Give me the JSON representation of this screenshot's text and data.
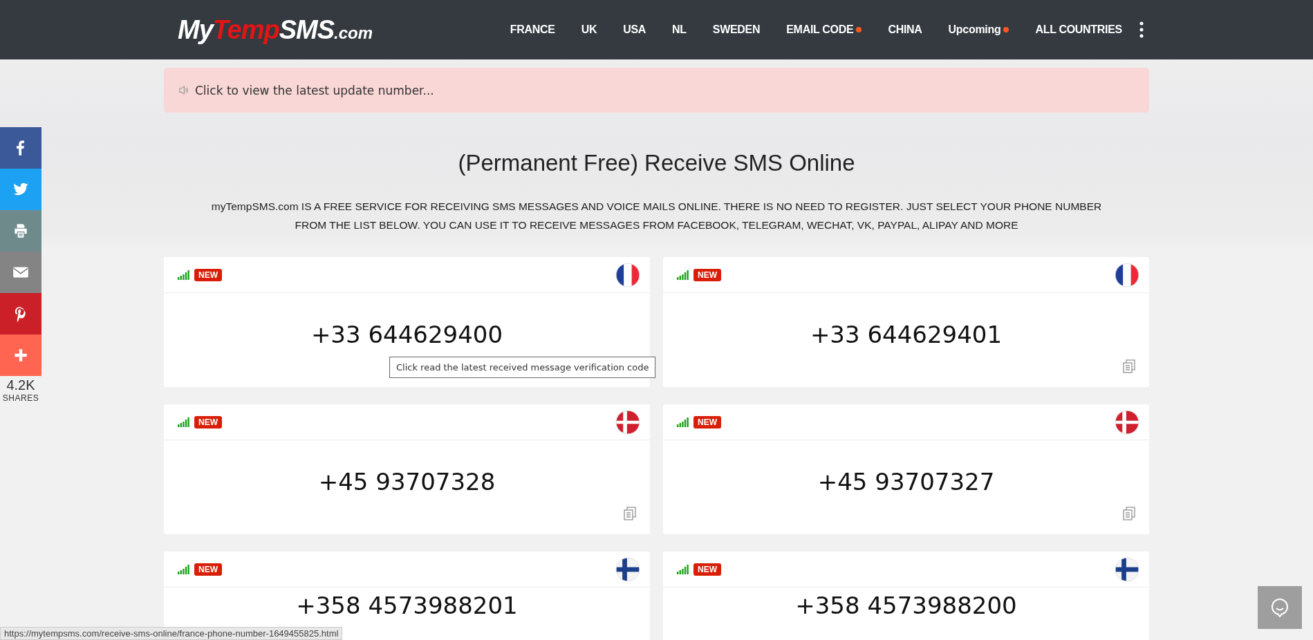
{
  "header": {
    "logo": [
      {
        "text": "My",
        "kind": "plain"
      },
      {
        "text": "Temp",
        "kind": "accent"
      },
      {
        "text": "SMS",
        "kind": "plain"
      },
      {
        "text": ".com",
        "kind": "small"
      }
    ],
    "nav": [
      {
        "label": "FRANCE",
        "dot": false
      },
      {
        "label": "UK",
        "dot": false
      },
      {
        "label": "USA",
        "dot": false
      },
      {
        "label": "NL",
        "dot": false
      },
      {
        "label": "SWEDEN",
        "dot": false
      },
      {
        "label": "EMAIL CODE",
        "dot": true
      },
      {
        "label": "CHINA",
        "dot": false
      },
      {
        "label": "Upcoming",
        "dot": true
      },
      {
        "label": "ALL COUNTRIES",
        "dot": false
      }
    ]
  },
  "notice": "Click to view the latest update number...",
  "title": "(Permanent Free) Receive SMS Online",
  "description": "myTempSMS.com IS A FREE SERVICE FOR RECEIVING SMS MESSAGES AND VOICE MAILS ONLINE. THERE IS NO NEED TO REGISTER. JUST SELECT YOUR PHONE NUMBER FROM THE LIST BELOW. YOU CAN USE IT TO RECEIVE MESSAGES FROM FACEBOOK, TELEGRAM, WECHAT, VK, PAYPAL, ALIPAY AND MORE",
  "cards": [
    {
      "badge": "NEW",
      "flag": {
        "kind": "france"
      },
      "number": "+33 644629400",
      "copy_icon": false
    },
    {
      "badge": "NEW",
      "flag": {
        "kind": "france"
      },
      "number": "+33 644629401",
      "copy_icon": true
    },
    {
      "badge": "NEW",
      "flag": {
        "kind": "denmark"
      },
      "number": "+45 93707328",
      "copy_icon": true
    },
    {
      "badge": "NEW",
      "flag": {
        "kind": "denmark"
      },
      "number": "+45 93707327",
      "copy_icon": true
    },
    {
      "badge": "NEW",
      "flag": {
        "kind": "finland"
      },
      "number": "+358 4573988201",
      "copy_icon": false
    },
    {
      "badge": "NEW",
      "flag": {
        "kind": "finland"
      },
      "number": "+358 4573988200",
      "copy_icon": false
    }
  ],
  "tooltip": "Click read the latest received message verification code",
  "share": {
    "buttons": [
      {
        "kind": "facebook"
      },
      {
        "kind": "twitter"
      },
      {
        "kind": "print"
      },
      {
        "kind": "email"
      },
      {
        "kind": "pinterest"
      },
      {
        "kind": "more"
      }
    ],
    "count": "4.2K",
    "label": "SHARES"
  },
  "status_bar": "https://mytempsms.com/receive-sms-online/france-phone-number-1649455825.html"
}
